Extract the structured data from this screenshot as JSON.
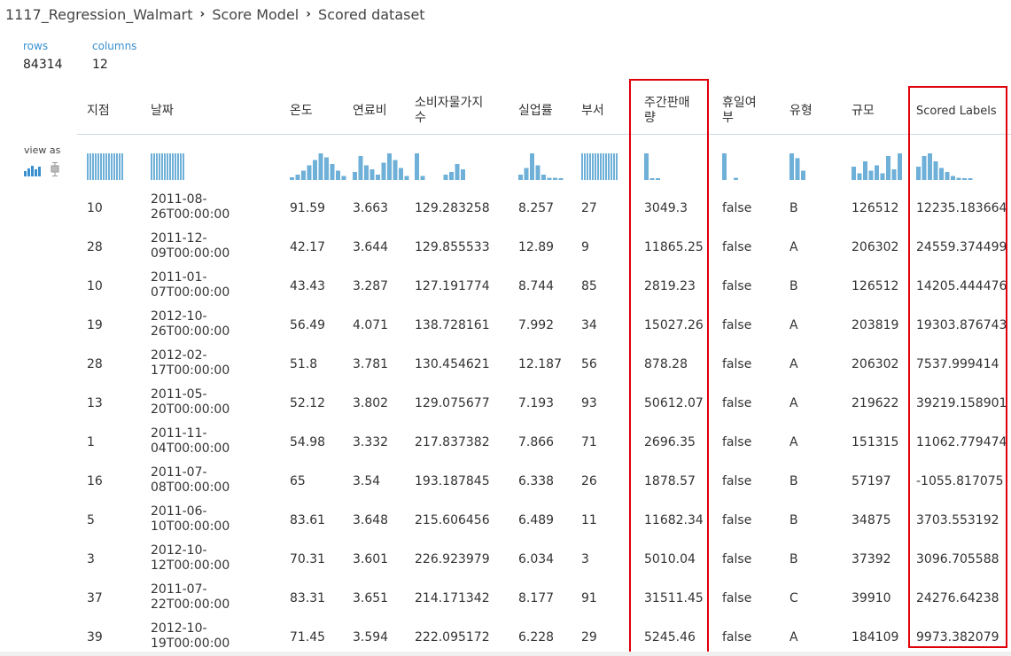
{
  "breadcrumb": [
    "1117_Regression_Walmart",
    "Score Model",
    "Scored dataset"
  ],
  "stats": {
    "rows_label": "rows",
    "rows_value": "84314",
    "columns_label": "columns",
    "columns_value": "12"
  },
  "view_as_label": "view as",
  "accent_color": "#3a8fcf",
  "highlight_color": "#e0000a",
  "columns": [
    {
      "key": "store",
      "label": "지점",
      "hist": [
        1,
        1,
        1,
        1,
        1,
        1,
        1,
        1,
        1,
        1,
        1,
        1,
        1,
        1
      ]
    },
    {
      "key": "date",
      "label": "날짜",
      "hist": [
        1,
        1,
        1,
        1,
        1,
        1,
        1,
        1,
        1,
        1,
        1,
        1,
        1
      ]
    },
    {
      "key": "temp",
      "label": "온도",
      "hist": [
        0.1,
        0.2,
        0.35,
        0.55,
        0.75,
        1,
        0.85,
        0.6,
        0.35,
        0.15
      ]
    },
    {
      "key": "fuel",
      "label": "연료비",
      "hist": [
        0.3,
        0.9,
        0.55,
        0.4,
        0.2,
        0.65,
        1,
        0.75,
        0.45,
        0.15
      ]
    },
    {
      "key": "cpi",
      "label": "소비자물가지수",
      "hist": [
        1,
        0.15,
        0,
        0,
        0,
        0.2,
        0.3,
        0.6,
        0.4,
        0
      ]
    },
    {
      "key": "unemp",
      "label": "실업률",
      "hist": [
        0.2,
        0.45,
        1,
        0.55,
        0.2,
        0.08,
        0.08,
        0.04
      ]
    },
    {
      "key": "dept",
      "label": "부서",
      "hist": [
        1,
        1,
        1,
        1,
        1,
        1,
        1,
        1,
        1,
        1,
        1,
        1,
        1,
        1
      ]
    },
    {
      "key": "weekly_sales",
      "label": "주간판매량",
      "hist": [
        1,
        0.05,
        0.02
      ]
    },
    {
      "key": "holiday",
      "label": "휴일여부",
      "hist": [
        1,
        0,
        0.08
      ]
    },
    {
      "key": "type",
      "label": "유형",
      "hist": [
        1,
        0.82,
        0.35
      ]
    },
    {
      "key": "size",
      "label": "규모",
      "hist": [
        0.5,
        0.25,
        0.7,
        0.35,
        0.55,
        0.25,
        0.9,
        0.4,
        1
      ]
    },
    {
      "key": "scored",
      "label": "Scored Labels",
      "hist": [
        0.5,
        0.9,
        1,
        0.7,
        0.45,
        0.3,
        0.15,
        0.08,
        0.04,
        0.02
      ]
    }
  ],
  "rows": [
    {
      "store": "10",
      "date": "2011-08-26T00:00:00",
      "temp": "91.59",
      "fuel": "3.663",
      "cpi": "129.283258",
      "unemp": "8.257",
      "dept": "27",
      "weekly_sales": "3049.3",
      "holiday": "false",
      "type": "B",
      "size": "126512",
      "scored": "12235.183664"
    },
    {
      "store": "28",
      "date": "2011-12-09T00:00:00",
      "temp": "42.17",
      "fuel": "3.644",
      "cpi": "129.855533",
      "unemp": "12.89",
      "dept": "9",
      "weekly_sales": "11865.25",
      "holiday": "false",
      "type": "A",
      "size": "206302",
      "scored": "24559.374499"
    },
    {
      "store": "10",
      "date": "2011-01-07T00:00:00",
      "temp": "43.43",
      "fuel": "3.287",
      "cpi": "127.191774",
      "unemp": "8.744",
      "dept": "85",
      "weekly_sales": "2819.23",
      "holiday": "false",
      "type": "B",
      "size": "126512",
      "scored": "14205.444476"
    },
    {
      "store": "19",
      "date": "2012-10-26T00:00:00",
      "temp": "56.49",
      "fuel": "4.071",
      "cpi": "138.728161",
      "unemp": "7.992",
      "dept": "34",
      "weekly_sales": "15027.26",
      "holiday": "false",
      "type": "A",
      "size": "203819",
      "scored": "19303.876743"
    },
    {
      "store": "28",
      "date": "2012-02-17T00:00:00",
      "temp": "51.8",
      "fuel": "3.781",
      "cpi": "130.454621",
      "unemp": "12.187",
      "dept": "56",
      "weekly_sales": "878.28",
      "holiday": "false",
      "type": "A",
      "size": "206302",
      "scored": "7537.999414"
    },
    {
      "store": "13",
      "date": "2011-05-20T00:00:00",
      "temp": "52.12",
      "fuel": "3.802",
      "cpi": "129.075677",
      "unemp": "7.193",
      "dept": "93",
      "weekly_sales": "50612.07",
      "holiday": "false",
      "type": "A",
      "size": "219622",
      "scored": "39219.158901"
    },
    {
      "store": "1",
      "date": "2011-11-04T00:00:00",
      "temp": "54.98",
      "fuel": "3.332",
      "cpi": "217.837382",
      "unemp": "7.866",
      "dept": "71",
      "weekly_sales": "2696.35",
      "holiday": "false",
      "type": "A",
      "size": "151315",
      "scored": "11062.779474"
    },
    {
      "store": "16",
      "date": "2011-07-08T00:00:00",
      "temp": "65",
      "fuel": "3.54",
      "cpi": "193.187845",
      "unemp": "6.338",
      "dept": "26",
      "weekly_sales": "1878.57",
      "holiday": "false",
      "type": "B",
      "size": "57197",
      "scored": "-1055.817075"
    },
    {
      "store": "5",
      "date": "2011-06-10T00:00:00",
      "temp": "83.61",
      "fuel": "3.648",
      "cpi": "215.606456",
      "unemp": "6.489",
      "dept": "11",
      "weekly_sales": "11682.34",
      "holiday": "false",
      "type": "B",
      "size": "34875",
      "scored": "3703.553192"
    },
    {
      "store": "3",
      "date": "2012-10-12T00:00:00",
      "temp": "70.31",
      "fuel": "3.601",
      "cpi": "226.923979",
      "unemp": "6.034",
      "dept": "3",
      "weekly_sales": "5010.04",
      "holiday": "false",
      "type": "B",
      "size": "37392",
      "scored": "3096.705588"
    },
    {
      "store": "37",
      "date": "2011-07-22T00:00:00",
      "temp": "83.31",
      "fuel": "3.651",
      "cpi": "214.171342",
      "unemp": "8.177",
      "dept": "91",
      "weekly_sales": "31511.45",
      "holiday": "false",
      "type": "C",
      "size": "39910",
      "scored": "24276.64238"
    },
    {
      "store": "39",
      "date": "2012-10-19T00:00:00",
      "temp": "71.45",
      "fuel": "3.594",
      "cpi": "222.095172",
      "unemp": "6.228",
      "dept": "29",
      "weekly_sales": "5245.46",
      "holiday": "false",
      "type": "A",
      "size": "184109",
      "scored": "9973.382079"
    }
  ]
}
